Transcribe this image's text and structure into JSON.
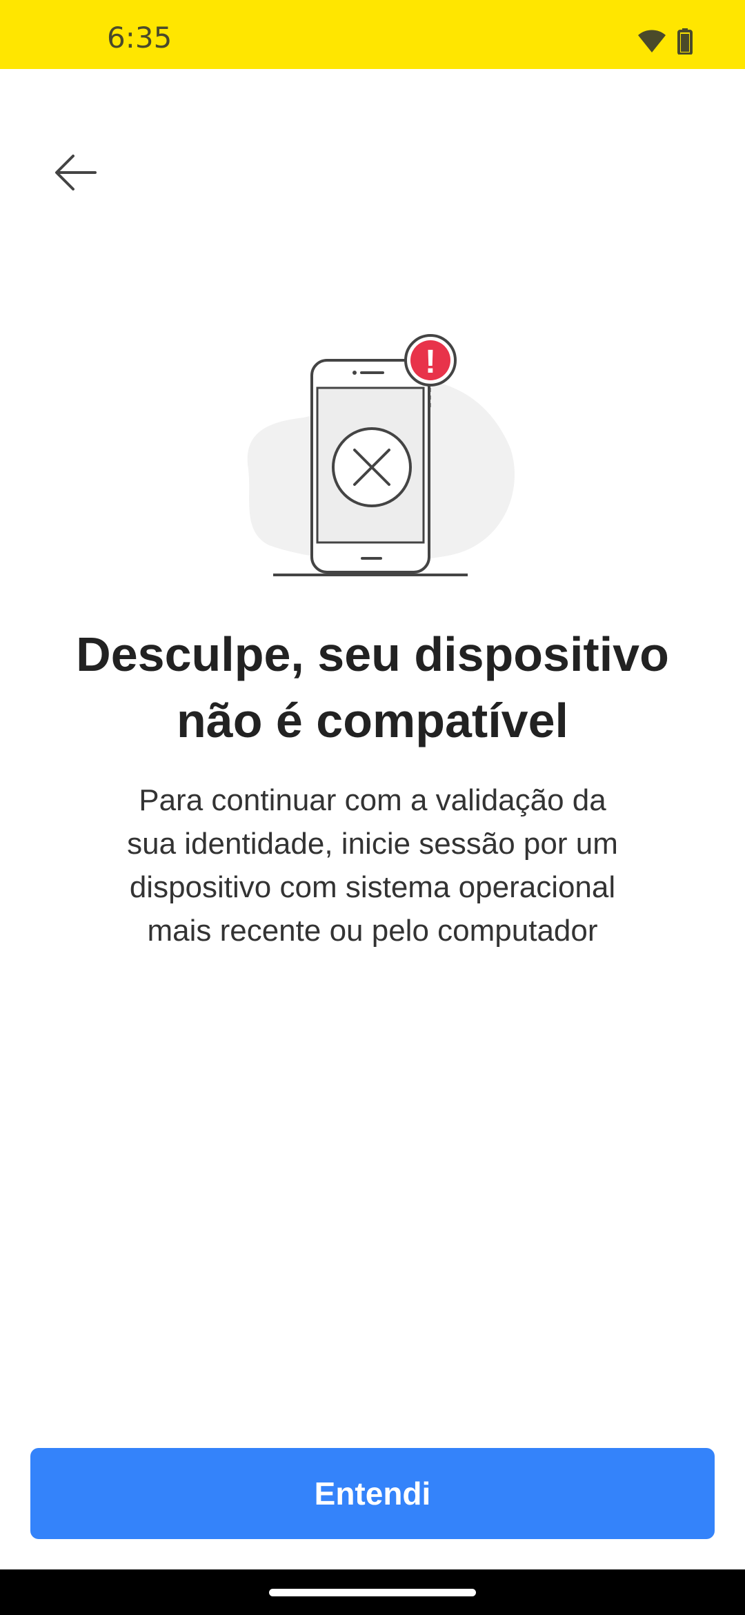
{
  "status_bar": {
    "time": "6:35",
    "icons": [
      "wifi-icon",
      "battery-icon"
    ],
    "background_color": "#FFE600"
  },
  "header": {
    "back_icon": "arrow-left-icon"
  },
  "illustration": {
    "icon": "incompatible-phone-illustration",
    "badge": "!",
    "badge_color": "#E8334A"
  },
  "content": {
    "title_line1": "Desculpe, seu dispositivo",
    "title_line2": "não é compatível",
    "description_line1": "Para continuar com a validação da",
    "description_line2": "sua identidade, inicie sessão por um",
    "description_line3": "dispositivo com sistema operacional",
    "description_line4": "mais recente ou pelo computador"
  },
  "actions": {
    "primary_label": "Entendi",
    "primary_color": "#3483FA"
  }
}
